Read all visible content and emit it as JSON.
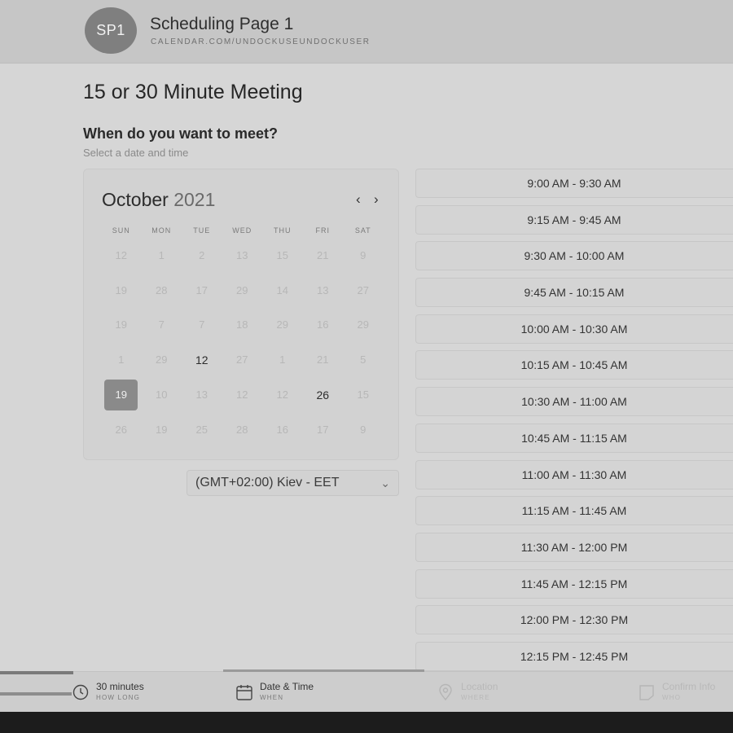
{
  "header": {
    "avatar_initials": "SP1",
    "title": "Scheduling Page 1",
    "url": "CALENDAR.COM/UNDOCKUSEUNDOCKUSER"
  },
  "meeting": {
    "title": "15 or 30 Minute Meeting",
    "prompt": "When do you want to meet?",
    "subprompt": "Select a date and time"
  },
  "calendar": {
    "month": "October",
    "year": "2021",
    "prev_icon": "‹",
    "next_icon": "›",
    "weekdays": [
      "SUN",
      "MON",
      "TUE",
      "WED",
      "THU",
      "FRI",
      "SAT"
    ],
    "weeks": [
      [
        "12",
        "1",
        "2",
        "13",
        "15",
        "21",
        "9"
      ],
      [
        "19",
        "28",
        "17",
        "29",
        "14",
        "13",
        "27"
      ],
      [
        "19",
        "7",
        "7",
        "18",
        "29",
        "16",
        "29"
      ],
      [
        "1",
        "29",
        "12",
        "27",
        "1",
        "21",
        "5"
      ],
      [
        "19",
        "10",
        "13",
        "12",
        "12",
        "26",
        "15"
      ],
      [
        "26",
        "19",
        "25",
        "28",
        "16",
        "17",
        "9"
      ]
    ],
    "active_days": [
      "3-2",
      "4-5"
    ],
    "selected_day": "4-0"
  },
  "timezone": {
    "value": "(GMT+02:00) Kiev - EET"
  },
  "slots": [
    "9:00 AM - 9:30 AM",
    "9:15 AM - 9:45 AM",
    "9:30 AM - 10:00 AM",
    "9:45 AM - 10:15 AM",
    "10:00 AM - 10:30 AM",
    "10:15 AM - 10:45 AM",
    "10:30 AM - 11:00 AM",
    "10:45 AM - 11:15 AM",
    "11:00 AM - 11:30 AM",
    "11:15 AM - 11:45 AM",
    "11:30 AM - 12:00 PM",
    "11:45 AM - 12:15 PM",
    "12:00 PM - 12:30 PM",
    "12:15 PM - 12:45 PM"
  ],
  "steps": [
    {
      "label": "30 minutes",
      "sub": "HOW LONG",
      "icon": "clock-icon"
    },
    {
      "label": "Date & Time",
      "sub": "WHEN",
      "icon": "calendar-icon"
    },
    {
      "label": "Location",
      "sub": "WHERE",
      "icon": "location-pin-icon"
    },
    {
      "label": "Confirm Info",
      "sub": "WHO",
      "icon": "confirm-icon"
    }
  ]
}
